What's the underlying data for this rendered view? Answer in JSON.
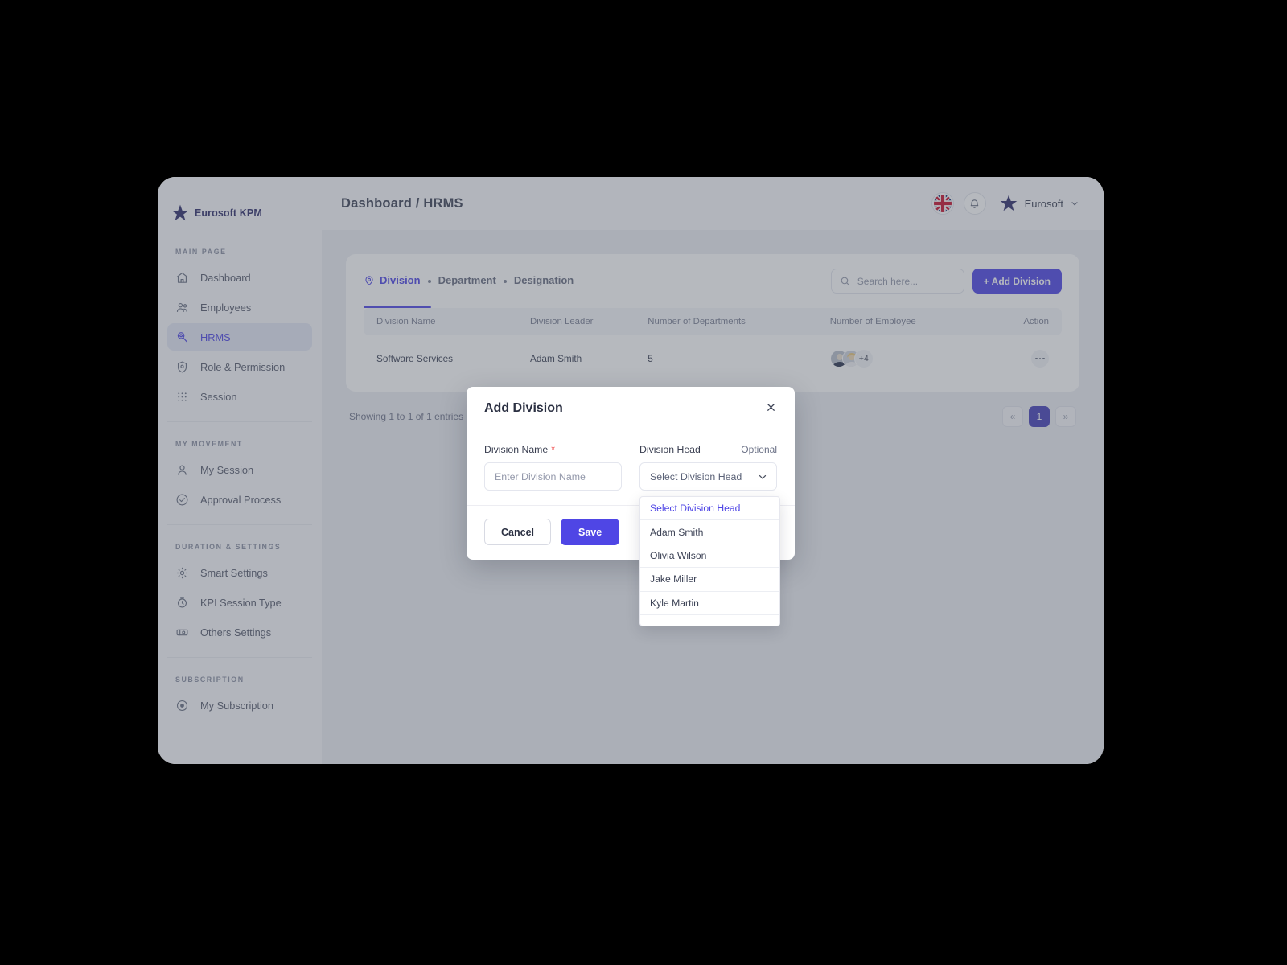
{
  "sidebar": {
    "brand": "Eurosoft KPM",
    "sections": [
      {
        "title": "MAIN PAGE",
        "items": [
          {
            "label": "Dashboard",
            "icon": "home-icon",
            "active": false
          },
          {
            "label": "Employees",
            "icon": "users-icon",
            "active": false
          },
          {
            "label": "HRMS",
            "icon": "hrms-icon",
            "active": true
          },
          {
            "label": "Role & Permission",
            "icon": "shield-icon",
            "active": false
          },
          {
            "label": "Session",
            "icon": "grid-dots-icon",
            "active": false
          }
        ]
      },
      {
        "title": "MY MOVEMENT",
        "items": [
          {
            "label": "My Session",
            "icon": "user-icon",
            "active": false
          },
          {
            "label": "Approval Process",
            "icon": "check-circle-icon",
            "active": false
          }
        ]
      },
      {
        "title": "DURATION & SETTINGS",
        "items": [
          {
            "label": "Smart Settings",
            "icon": "gear-icon",
            "active": false
          },
          {
            "label": "KPI Session Type",
            "icon": "clock-icon",
            "active": false
          },
          {
            "label": "Others Settings",
            "icon": "ticket-icon",
            "active": false
          }
        ]
      },
      {
        "title": "SUBSCRIPTION",
        "items": [
          {
            "label": "My Subscription",
            "icon": "badge-icon",
            "active": false
          }
        ]
      }
    ]
  },
  "topbar": {
    "breadcrumb": "Dashboard / HRMS",
    "language_icon": "uk-flag-icon",
    "notification_icon": "bell-icon",
    "user_name": "Eurosoft",
    "user_avatar_icon": "star-avatar-icon",
    "user_chevron_icon": "chevron-down-icon"
  },
  "card": {
    "tabs": [
      {
        "label": "Division",
        "active": true,
        "icon": "division-pin-icon"
      },
      {
        "label": "Department",
        "active": false
      },
      {
        "label": "Designation",
        "active": false
      }
    ],
    "search": {
      "placeholder": "Search here...",
      "value": "",
      "icon": "search-icon"
    },
    "add_button": "+ Add Division",
    "table": {
      "columns": [
        "Division Name",
        "Division Leader",
        "Number of Departments",
        "Number of Employee",
        "Action"
      ],
      "rows": [
        {
          "division_name": "Software Services",
          "division_leader": "Adam Smith",
          "number_of_departments": "5",
          "employee_overflow": "+4",
          "action_icon": "kebab-menu-icon"
        }
      ]
    },
    "footer": {
      "showing_text": "Showing 1 to 1 of 1 entries",
      "pager": {
        "prev_label": "«",
        "pages": [
          "1"
        ],
        "next_label": "»",
        "current": "1"
      }
    }
  },
  "modal": {
    "title": "Add Division",
    "close_icon": "close-icon",
    "fields": {
      "division_name": {
        "label": "Division Name",
        "required_marker": "*",
        "placeholder": "Enter Division Name",
        "value": ""
      },
      "division_head": {
        "label": "Division Head",
        "optional_label": "Optional",
        "value": "Select Division Head",
        "chevron_icon": "chevron-down-icon"
      }
    },
    "cancel_label": "Cancel",
    "save_label": "Save"
  },
  "dropdown": {
    "options": [
      {
        "label": "Select Division Head",
        "selected": true
      },
      {
        "label": "Adam Smith",
        "selected": false
      },
      {
        "label": "Olivia Wilson",
        "selected": false
      },
      {
        "label": "Jake Miller",
        "selected": false
      },
      {
        "label": "Kyle Martin",
        "selected": false
      }
    ]
  },
  "colors": {
    "accent": "#4f46e5",
    "pager_active": "#4540b8",
    "required": "#ef4444",
    "sidebar_active_bg": "#e3e7f5"
  }
}
